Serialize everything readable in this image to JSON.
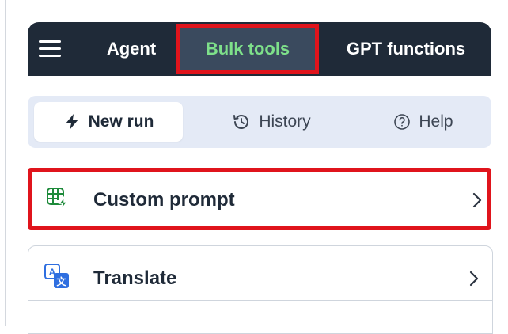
{
  "nav": {
    "menu_icon": "hamburger-menu-icon",
    "tabs": [
      {
        "label": "Agent",
        "active": false
      },
      {
        "label": "Bulk tools",
        "active": true
      },
      {
        "label": "GPT functions",
        "active": false
      }
    ]
  },
  "toolbar": {
    "new_run": {
      "label": "New run",
      "icon": "lightning-bolt-icon"
    },
    "history": {
      "label": "History",
      "icon": "history-clock-icon"
    },
    "help": {
      "label": "Help",
      "icon": "question-circle-icon"
    }
  },
  "tools": [
    {
      "label": "Custom prompt",
      "icon": "spreadsheet-bolt-icon",
      "highlighted": true
    },
    {
      "label": "Translate",
      "icon": "translate-icon",
      "highlighted": false
    }
  ],
  "colors": {
    "nav_bg": "#1f2a38",
    "active_tab_text": "#7ee08a",
    "highlight": "#e0141c",
    "toolbar_bg": "#e4eaf6",
    "icon_green": "#1d8a3a",
    "icon_blue": "#2f6fe0"
  }
}
